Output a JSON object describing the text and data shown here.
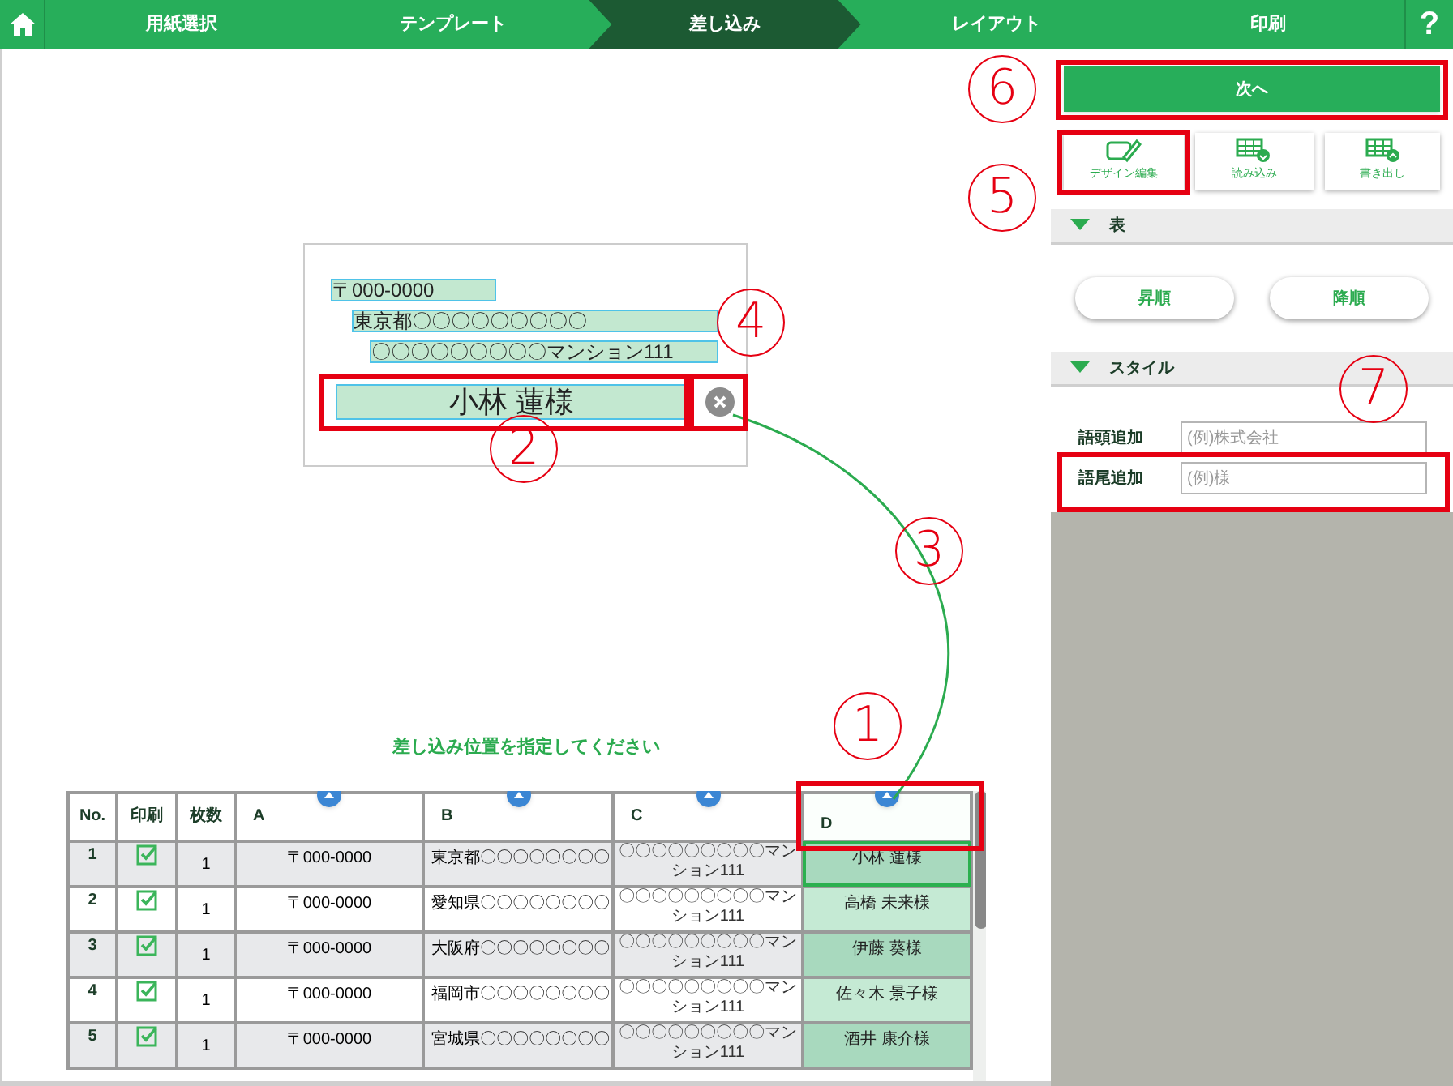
{
  "nav": {
    "steps": [
      {
        "label": "用紙選択",
        "selected": false
      },
      {
        "label": "テンプレート",
        "selected": false
      },
      {
        "label": "差し込み",
        "selected": true
      },
      {
        "label": "レイアウト",
        "selected": false
      },
      {
        "label": "印刷",
        "selected": false
      }
    ],
    "help": "?"
  },
  "preview": {
    "lines": [
      {
        "text": "〒000-0000"
      },
      {
        "text": "東京都〇〇〇〇〇〇〇〇〇"
      },
      {
        "text": "〇〇〇〇〇〇〇〇〇マンション111"
      }
    ],
    "name_field": {
      "text": "小林 蓮様"
    }
  },
  "instruction": "差し込み位置を指定してください",
  "table": {
    "columns": [
      {
        "label": "No.",
        "kind": "index",
        "insert_button": false,
        "target": false
      },
      {
        "label": "印刷",
        "kind": "check",
        "insert_button": false,
        "target": false
      },
      {
        "label": "枚数",
        "kind": "count",
        "insert_button": false,
        "target": false
      },
      {
        "label": "A",
        "kind": "data",
        "insert_button": true,
        "target": false
      },
      {
        "label": "B",
        "kind": "data",
        "insert_button": true,
        "target": false
      },
      {
        "label": "C",
        "kind": "data",
        "insert_button": true,
        "target": false
      },
      {
        "label": "D",
        "kind": "data",
        "insert_button": true,
        "target": true
      }
    ],
    "rows": [
      {
        "no": "1",
        "print": true,
        "count": "1",
        "a": "〒000-0000",
        "b": "東京都〇〇〇〇〇〇〇〇",
        "c": "〇〇〇〇〇〇〇〇〇マンション111",
        "d": "小林 蓮様",
        "selected": true
      },
      {
        "no": "2",
        "print": true,
        "count": "1",
        "a": "〒000-0000",
        "b": "愛知県〇〇〇〇〇〇〇〇",
        "c": "〇〇〇〇〇〇〇〇〇マンション111",
        "d": "高橋 未来様",
        "selected": false
      },
      {
        "no": "3",
        "print": true,
        "count": "1",
        "a": "〒000-0000",
        "b": "大阪府〇〇〇〇〇〇〇〇",
        "c": "〇〇〇〇〇〇〇〇〇マンション111",
        "d": "伊藤 葵様",
        "selected": false
      },
      {
        "no": "4",
        "print": true,
        "count": "1",
        "a": "〒000-0000",
        "b": "福岡市〇〇〇〇〇〇〇〇",
        "c": "〇〇〇〇〇〇〇〇〇マンション111",
        "d": "佐々木 景子様",
        "selected": false
      },
      {
        "no": "5",
        "print": true,
        "count": "1",
        "a": "〒000-0000",
        "b": "宮城県〇〇〇〇〇〇〇〇",
        "c": "〇〇〇〇〇〇〇〇〇マンション111",
        "d": "酒井 康介様",
        "selected": false
      }
    ]
  },
  "panel": {
    "next_button": "次へ",
    "tools": [
      {
        "label": "デザイン編集",
        "kind": "design"
      },
      {
        "label": "読み込み",
        "kind": "import"
      },
      {
        "label": "書き出し",
        "kind": "export"
      }
    ],
    "sections": [
      {
        "title": "表",
        "expanded": true,
        "kind": "sort",
        "buttons": [
          "昇順",
          "降順"
        ]
      },
      {
        "title": "スタイル",
        "expanded": true,
        "kind": "style",
        "fields": [
          {
            "label": "語頭追加",
            "placeholder": "(例)株式会社"
          },
          {
            "label": "語尾追加",
            "placeholder": "(例)様"
          }
        ]
      }
    ]
  },
  "annotations": [
    {
      "number": "6"
    },
    {
      "number": "5"
    },
    {
      "number": "4"
    },
    {
      "number": "2"
    },
    {
      "number": "3"
    },
    {
      "number": "7"
    },
    {
      "number": "1"
    }
  ]
}
